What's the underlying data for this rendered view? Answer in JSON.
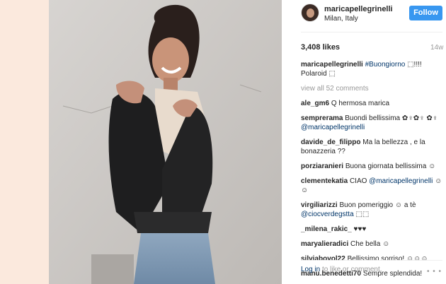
{
  "post": {
    "username": "maricapellegrinelli",
    "location": "Milan, Italy",
    "follow_label": "Follow",
    "likes": "3,408 likes",
    "time": "14w",
    "caption_user": "maricapellegrinelli",
    "caption_hashtag": "#Buongiorno",
    "caption_text": " ⬚!!!! Polaroid ⬚",
    "view_all": "view all 52 comments"
  },
  "comments": [
    {
      "user": "ale_gm6",
      "text": "Q hermosa marica"
    },
    {
      "user": "semprerama",
      "text": "Buondi bellissima ✿♀✿♀ ✿♀ ",
      "mention": "@maricapellegrinelli"
    },
    {
      "user": "davide_de_filippo",
      "text": "Ma la bellezza , e la bonazzeria ??"
    },
    {
      "user": "porziaranieri",
      "text": "Buona giornata bellissima ☺"
    },
    {
      "user": "clementekatia",
      "text": "CIAO ",
      "mention": "@maricapellegrinelli",
      "text2": " ☺☺"
    },
    {
      "user": "virgiliarizzi",
      "text": "Buon pomeriggio ☺ a tè ",
      "mention": "@ciocverdegstta",
      "text2": " ⬚⬚"
    },
    {
      "user": "_milena_rakic_",
      "text": "♥♥♥"
    },
    {
      "user": "maryalieradici",
      "text": "Che bella ☺"
    },
    {
      "user": "silviabovol22",
      "text": "Bellissimo sorriso! ☺☺☺"
    },
    {
      "user": "manu.benedetti70",
      "text": "Sempre splendida!"
    }
  ],
  "footer": {
    "login_link": "Log in",
    "login_rest": " to like or comment.",
    "more_icon": "more-options-icon",
    "more_glyph": "• • •"
  }
}
